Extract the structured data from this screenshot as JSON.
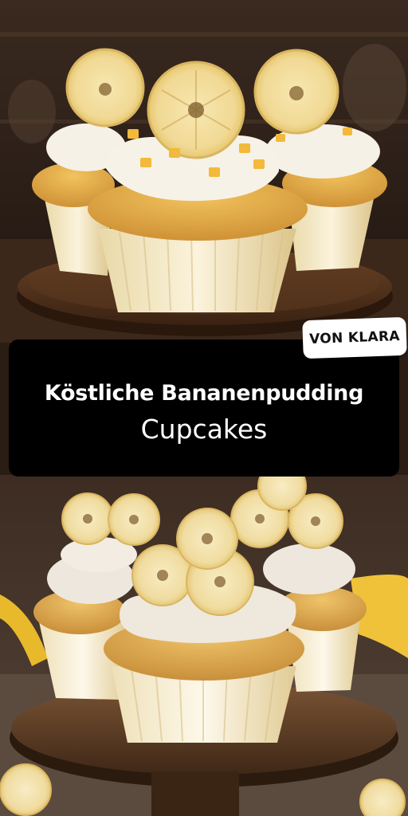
{
  "title": {
    "line1": "Köstliche Bananenpudding",
    "line2": "Cupcakes"
  },
  "author_badge": "VON KLARA",
  "colors": {
    "title_card_bg": "#000000",
    "title_text": "#ffffff",
    "badge_bg": "#ffffff",
    "badge_text": "#111111",
    "cake": "#e6b14d",
    "frosting": "#f5efe6",
    "banana": "#f3e0a0"
  }
}
